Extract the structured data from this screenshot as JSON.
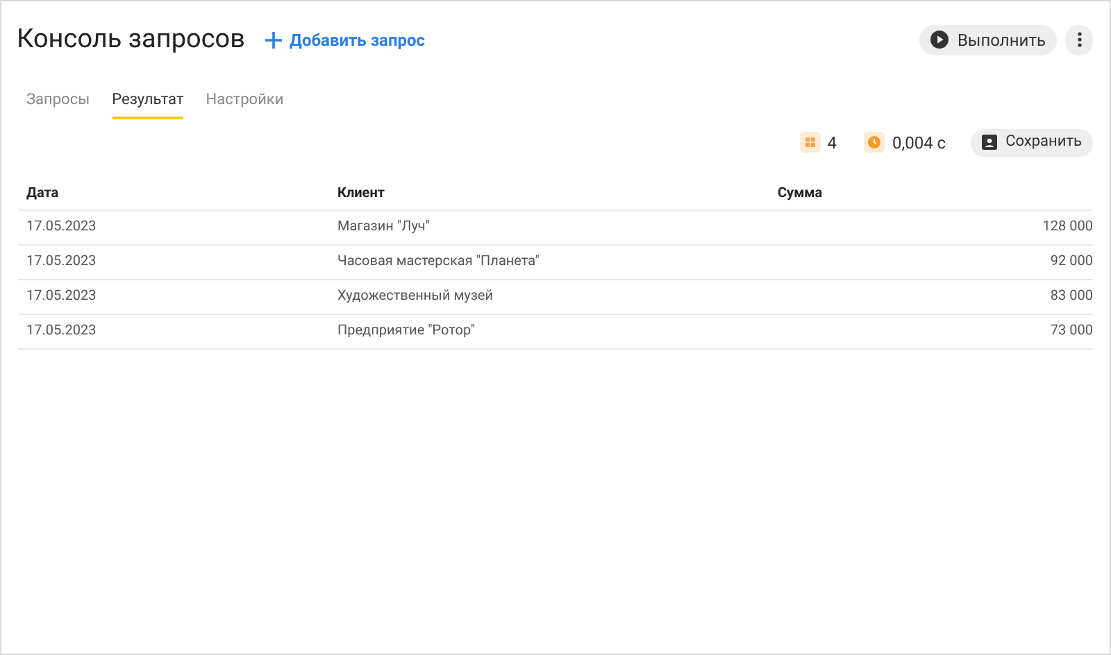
{
  "header": {
    "title": "Консоль запросов",
    "add_button": "Добавить запрос",
    "run_button": "Выполнить"
  },
  "tabs": [
    {
      "label": "Запросы",
      "selected": false
    },
    {
      "label": "Результат",
      "selected": true
    },
    {
      "label": "Настройки",
      "selected": false
    }
  ],
  "stats": {
    "row_count": "4",
    "duration": "0,004 с",
    "save_button": "Сохранить"
  },
  "table": {
    "columns": [
      "Дата",
      "Клиент",
      "Сумма"
    ],
    "rows": [
      [
        "17.05.2023",
        "Магазин \"Луч\"",
        "128 000"
      ],
      [
        "17.05.2023",
        "Часовая мастерская \"Планета\"",
        "92 000"
      ],
      [
        "17.05.2023",
        "Художественный музей",
        "83 000"
      ],
      [
        "17.05.2023",
        "Предприятие \"Ротор\"",
        "73 000"
      ]
    ]
  }
}
